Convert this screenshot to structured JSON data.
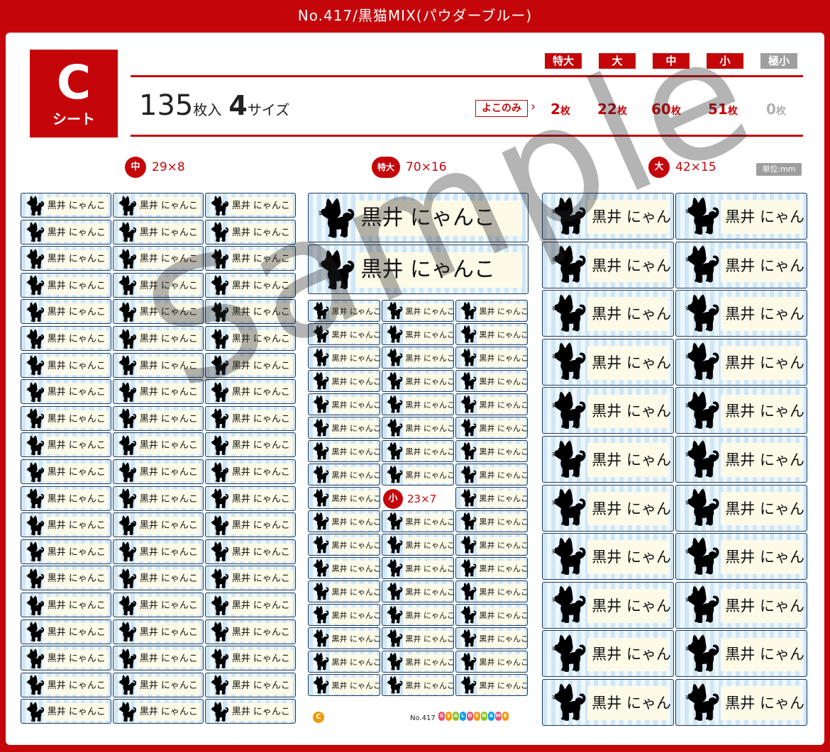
{
  "title": "No.417/黒猫MIX(パウダーブルー)",
  "sheet": {
    "letter": "C",
    "word": "シート"
  },
  "summary": {
    "count": "135",
    "count_unit": "枚入",
    "sizes": "4",
    "sizes_unit": "サイズ"
  },
  "sizes": [
    {
      "name": "特大",
      "qty": "2",
      "active": true
    },
    {
      "name": "大",
      "qty": "22",
      "active": true
    },
    {
      "name": "中",
      "qty": "60",
      "active": true
    },
    {
      "name": "小",
      "qty": "51",
      "active": true
    },
    {
      "name": "極小",
      "qty": "0",
      "active": false
    }
  ],
  "qty_unit": "枚",
  "yoko_label": "よこのみ",
  "sections": {
    "mid": {
      "badge": "中",
      "dims": "29×8"
    },
    "xl": {
      "badge": "特大",
      "dims": "70×16"
    },
    "large": {
      "badge": "大",
      "dims": "42×15"
    },
    "small": {
      "badge": "小",
      "dims": "23×7"
    },
    "unit": "単位:mm"
  },
  "label_name": "黒井 にゃんこ",
  "watermark": "Sample",
  "footer": {
    "c": "C",
    "no": "No.417",
    "logo": "SEALDENAME"
  },
  "colors": {
    "brand_red": "#c4060b",
    "powder_blue": "#cfe6f6",
    "cream": "#fdfbe8",
    "ribbon_pink": "#e0347a",
    "grey": "#9e9e9e"
  }
}
